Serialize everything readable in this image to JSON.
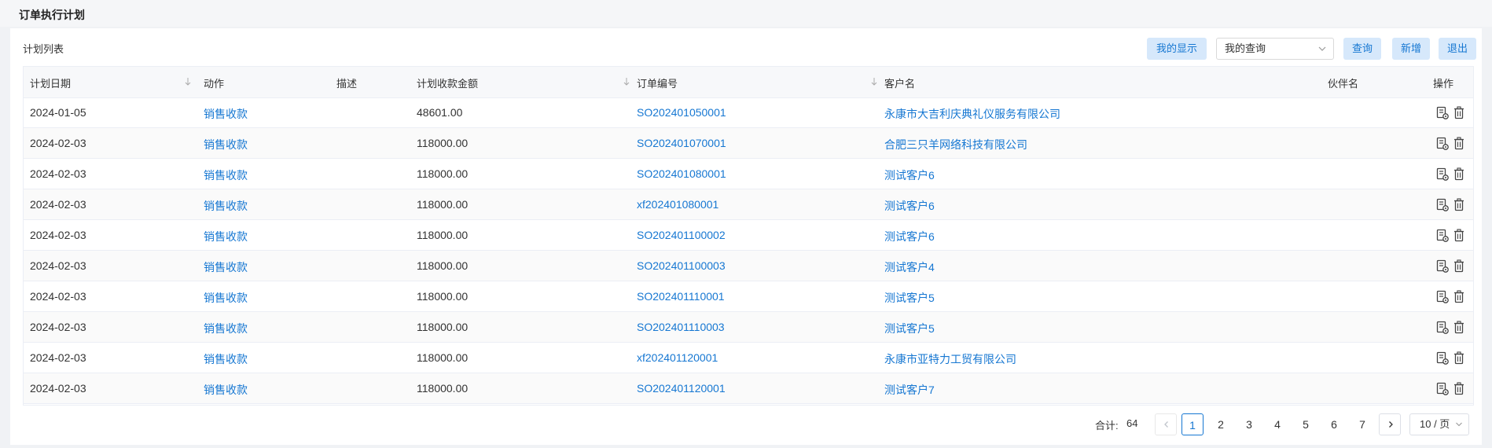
{
  "page": {
    "title": "订单执行计划"
  },
  "toolbar": {
    "list_title": "计划列表",
    "my_display": "我的显示",
    "my_query": "我的查询",
    "query": "查询",
    "add": "新增",
    "exit": "退出"
  },
  "table": {
    "headers": [
      "计划日期",
      "动作",
      "描述",
      "计划收款金额",
      "订单编号",
      "客户名",
      "伙伴名",
      "操作"
    ],
    "rows": [
      {
        "date": "2024-01-05",
        "action": "销售收款",
        "desc": "",
        "amount": "48601.00",
        "order": "SO202401050001",
        "customer": "永康市大吉利庆典礼仪服务有限公司",
        "partner": ""
      },
      {
        "date": "2024-02-03",
        "action": "销售收款",
        "desc": "",
        "amount": "118000.00",
        "order": "SO202401070001",
        "customer": "合肥三只羊网络科技有限公司",
        "partner": ""
      },
      {
        "date": "2024-02-03",
        "action": "销售收款",
        "desc": "",
        "amount": "118000.00",
        "order": "SO202401080001",
        "customer": "测试客户6",
        "partner": ""
      },
      {
        "date": "2024-02-03",
        "action": "销售收款",
        "desc": "",
        "amount": "118000.00",
        "order": "xf202401080001",
        "customer": "测试客户6",
        "partner": ""
      },
      {
        "date": "2024-02-03",
        "action": "销售收款",
        "desc": "",
        "amount": "118000.00",
        "order": "SO202401100002",
        "customer": "测试客户6",
        "partner": ""
      },
      {
        "date": "2024-02-03",
        "action": "销售收款",
        "desc": "",
        "amount": "118000.00",
        "order": "SO202401100003",
        "customer": "测试客户4",
        "partner": ""
      },
      {
        "date": "2024-02-03",
        "action": "销售收款",
        "desc": "",
        "amount": "118000.00",
        "order": "SO202401110001",
        "customer": "测试客户5",
        "partner": ""
      },
      {
        "date": "2024-02-03",
        "action": "销售收款",
        "desc": "",
        "amount": "118000.00",
        "order": "SO202401110003",
        "customer": "测试客户5",
        "partner": ""
      },
      {
        "date": "2024-02-03",
        "action": "销售收款",
        "desc": "",
        "amount": "118000.00",
        "order": "xf202401120001",
        "customer": "永康市亚特力工贸有限公司",
        "partner": ""
      },
      {
        "date": "2024-02-03",
        "action": "销售收款",
        "desc": "",
        "amount": "118000.00",
        "order": "SO202401120001",
        "customer": "测试客户7",
        "partner": ""
      }
    ]
  },
  "pagination": {
    "total_label": "合计:",
    "total": "64",
    "pages": [
      "1",
      "2",
      "3",
      "4",
      "5",
      "6",
      "7"
    ],
    "current_page": "1",
    "page_size": "10 / 页"
  },
  "colors": {
    "link": "#1677d2",
    "button_bg": "#d6e8fb",
    "header_bg": "#f7f8fa"
  },
  "icons": [
    "chevron-down-icon",
    "sort-icon",
    "view-icon",
    "delete-icon",
    "chevron-left-icon",
    "chevron-right-icon"
  ]
}
